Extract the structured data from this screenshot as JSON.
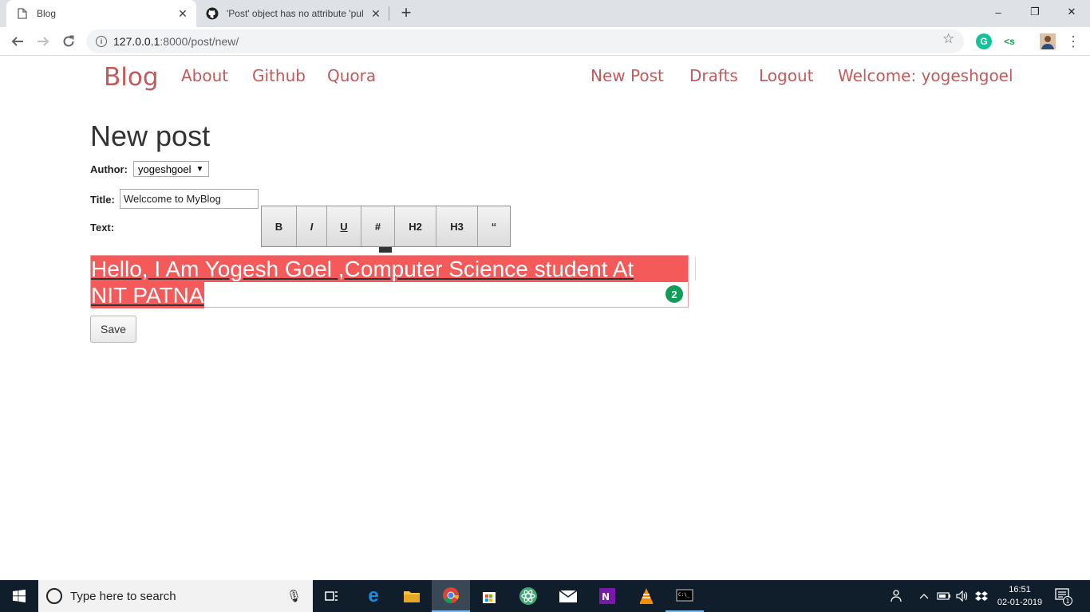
{
  "browser": {
    "tabs": [
      {
        "title": "Blog",
        "active": true
      },
      {
        "title": "'Post' object has no attribute 'pul",
        "active": false
      }
    ],
    "new_tab_label": "+",
    "url_host": "127.0.0.1",
    "url_path": ":8000/post/new/",
    "window_controls": [
      "–",
      "❐",
      "✕"
    ],
    "extensions": {
      "grammarly": "G",
      "code": "<s"
    }
  },
  "site_nav": {
    "brand": "Blog",
    "left_links": [
      "About",
      "Github",
      "Quora"
    ],
    "right_links": [
      "New Post",
      "Drafts",
      "Logout"
    ],
    "welcome": "Welcome: yogeshgoel"
  },
  "form": {
    "heading": "New post",
    "author_label": "Author:",
    "author_value": "yogeshgoel",
    "title_label": "Title:",
    "title_value": "Welccome to MyBlog",
    "text_label": "Text:",
    "toolbar_buttons": [
      "B",
      "I",
      "U",
      "#",
      "H2",
      "H3",
      "“"
    ],
    "text_line1": "Hello, I Am Yogesh Goel ,Computer Science student At",
    "text_line2": "NIT PATNA",
    "grammarly_issues": "2",
    "save_label": "Save"
  },
  "taskbar": {
    "search_placeholder": "Type here to search",
    "time": "16:51",
    "date": "02-01-2019",
    "notification_count": "1"
  }
}
